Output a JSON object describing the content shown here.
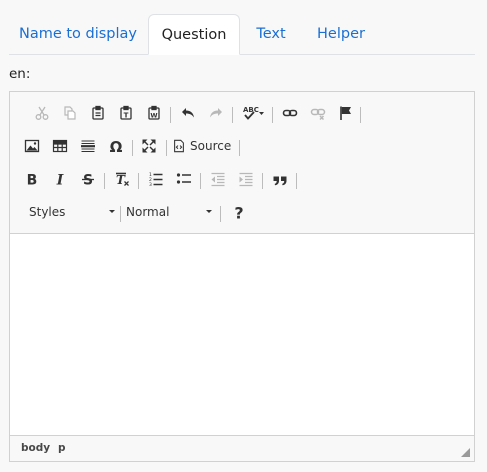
{
  "tabs": [
    {
      "label": "Name to display",
      "active": false
    },
    {
      "label": "Question",
      "active": true
    },
    {
      "label": "Text",
      "active": false
    },
    {
      "label": "Helper",
      "active": false
    }
  ],
  "language_label": "en:",
  "toolbar": {
    "source_label": "Source",
    "styles_combo": "Styles",
    "format_combo": "Normal",
    "icons": [
      "cut-icon",
      "copy-icon",
      "paste-icon",
      "paste-text-icon",
      "paste-word-icon",
      "undo-icon",
      "redo-icon",
      "spellcheck-icon",
      "link-icon",
      "unlink-icon",
      "anchor-icon",
      "image-icon",
      "table-icon",
      "horizontal-rule-icon",
      "special-char-icon",
      "maximize-icon",
      "source-icon",
      "bold-icon",
      "italic-icon",
      "strike-icon",
      "remove-format-icon",
      "numbered-list-icon",
      "bulleted-list-icon",
      "outdent-icon",
      "indent-icon",
      "blockquote-icon",
      "help-icon"
    ]
  },
  "statusbar": {
    "path": [
      "body",
      "p"
    ]
  }
}
